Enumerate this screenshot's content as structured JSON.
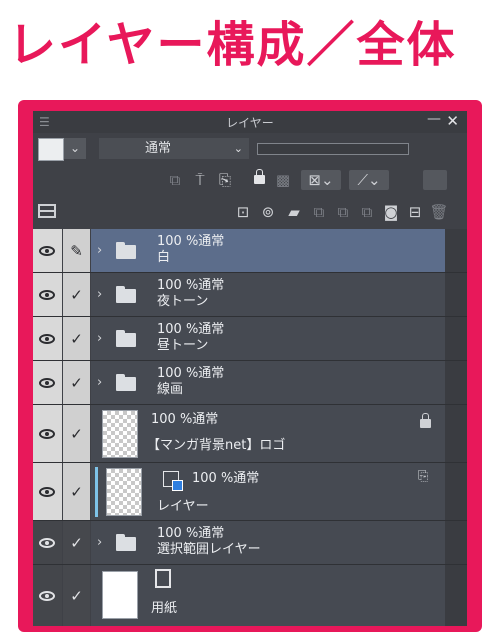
{
  "heading": "レイヤー構成／全体",
  "colors": {
    "accent": "#e8185a",
    "panel": "#3f4147",
    "selected_row": "#5c6d8b",
    "clip_indicator": "#7ec3e8"
  },
  "panel": {
    "title": "レイヤー",
    "menu_icon": "☰",
    "minimize": "—",
    "close": "✕",
    "blend_mode": "通常",
    "dropdown_arrow": "⌄"
  },
  "toolbar_icons": [
    "clip-to-lower-layer-icon",
    "set-as-reference-layer-icon",
    "draft-layer-icon",
    "lock-layer-icon",
    "lock-transparent-pixels-icon",
    "mask-options-icon",
    "ruler-options-icon",
    "palette-color-icon",
    "new-raster-layer-icon",
    "new-vector-layer-icon",
    "new-folder-icon",
    "combine-with-layer-below-icon",
    "merge-visible-icon",
    "create-layer-mask-icon",
    "apply-mask-icon",
    "delete-layer-icon"
  ],
  "layers": [
    {
      "line1": "100 %通常",
      "line2": "白",
      "type": "folder",
      "selected": true
    },
    {
      "line1": "100 %通常",
      "line2": "夜トーン",
      "type": "folder"
    },
    {
      "line1": "100 %通常",
      "line2": "昼トーン",
      "type": "folder"
    },
    {
      "line1": "100 %通常",
      "line2": "線画",
      "type": "folder"
    },
    {
      "line1": "100 %通常",
      "line2": "【マンガ背景net】ロゴ",
      "type": "raster",
      "locked": true
    },
    {
      "line1": "100 %通常",
      "line2": "レイヤー",
      "type": "raster",
      "clipped": true
    },
    {
      "line1": "100 %通常",
      "line2": "選択範囲レイヤー",
      "type": "folder"
    },
    {
      "line1": "",
      "line2": "用紙",
      "type": "paper"
    }
  ],
  "glyphs": {
    "chevron": "›",
    "check": "✓",
    "pen": "✎"
  }
}
